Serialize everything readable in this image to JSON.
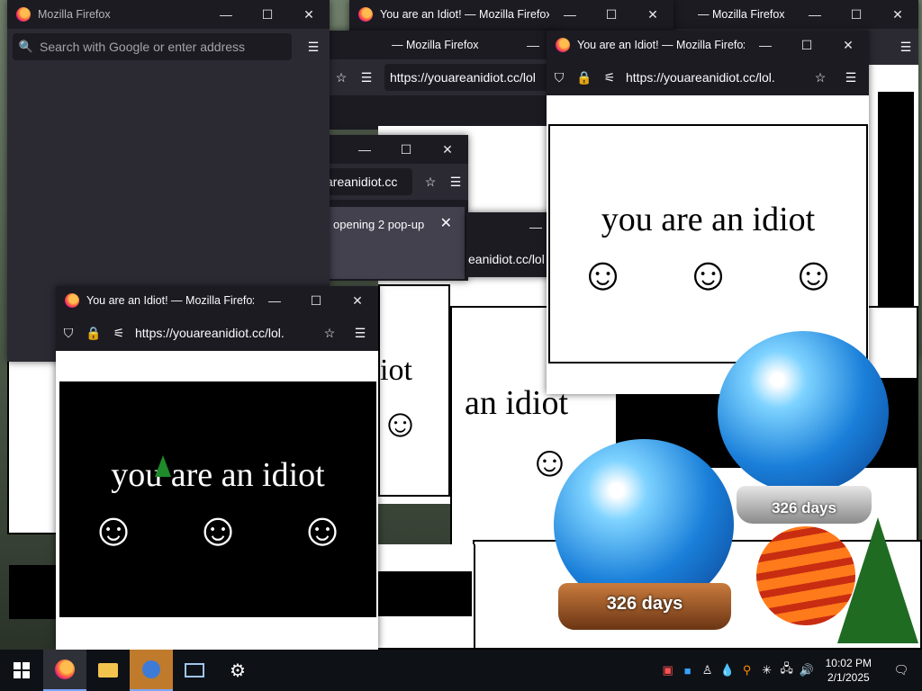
{
  "windows": {
    "search": {
      "title": "Mozilla Firefox",
      "search_placeholder": "Search with Google or enter address"
    },
    "main_popup": {
      "title": "You are an Idiot! — Mozilla Firefox",
      "url": "https://youareanidiot.cc/lol.",
      "text": "you are an idiot"
    },
    "right_popup": {
      "title": "You are an Idiot! — Mozilla Firefox",
      "url": "https://youareanidiot.cc/lol.",
      "text": "you are an idiot"
    },
    "top_popup": {
      "title": "You are an Idiot! — Mozilla Firefox",
      "url": "https://youareanidiot.cc/lol"
    },
    "top_back": {
      "title": "— Mozilla Firefox",
      "url": "https://youareanidiot.cc/lol"
    },
    "middle_popup": {
      "url": "areanidiot.cc",
      "notification": "opening 2 pop-up"
    },
    "small_popup": {
      "url": "eanidiot.cc/lol"
    },
    "far_back": {
      "title": "— Mozilla Firefox"
    }
  },
  "background_texts": {
    "a": "iot",
    "b": "an idiot",
    "c": "idiot"
  },
  "smiley": "☺",
  "globes": {
    "left_label": "326 days",
    "right_label": "326 days"
  },
  "window_controls": {
    "minimize": "—",
    "maximize": "☐",
    "close": "✕"
  },
  "icons": {
    "shield": "⛉",
    "lock": "🔒",
    "permissions": "⚟",
    "star": "☆",
    "menu": "☰",
    "search": "🔍"
  },
  "taskbar": {
    "time": "10:02 PM",
    "date": "2/1/2025"
  }
}
